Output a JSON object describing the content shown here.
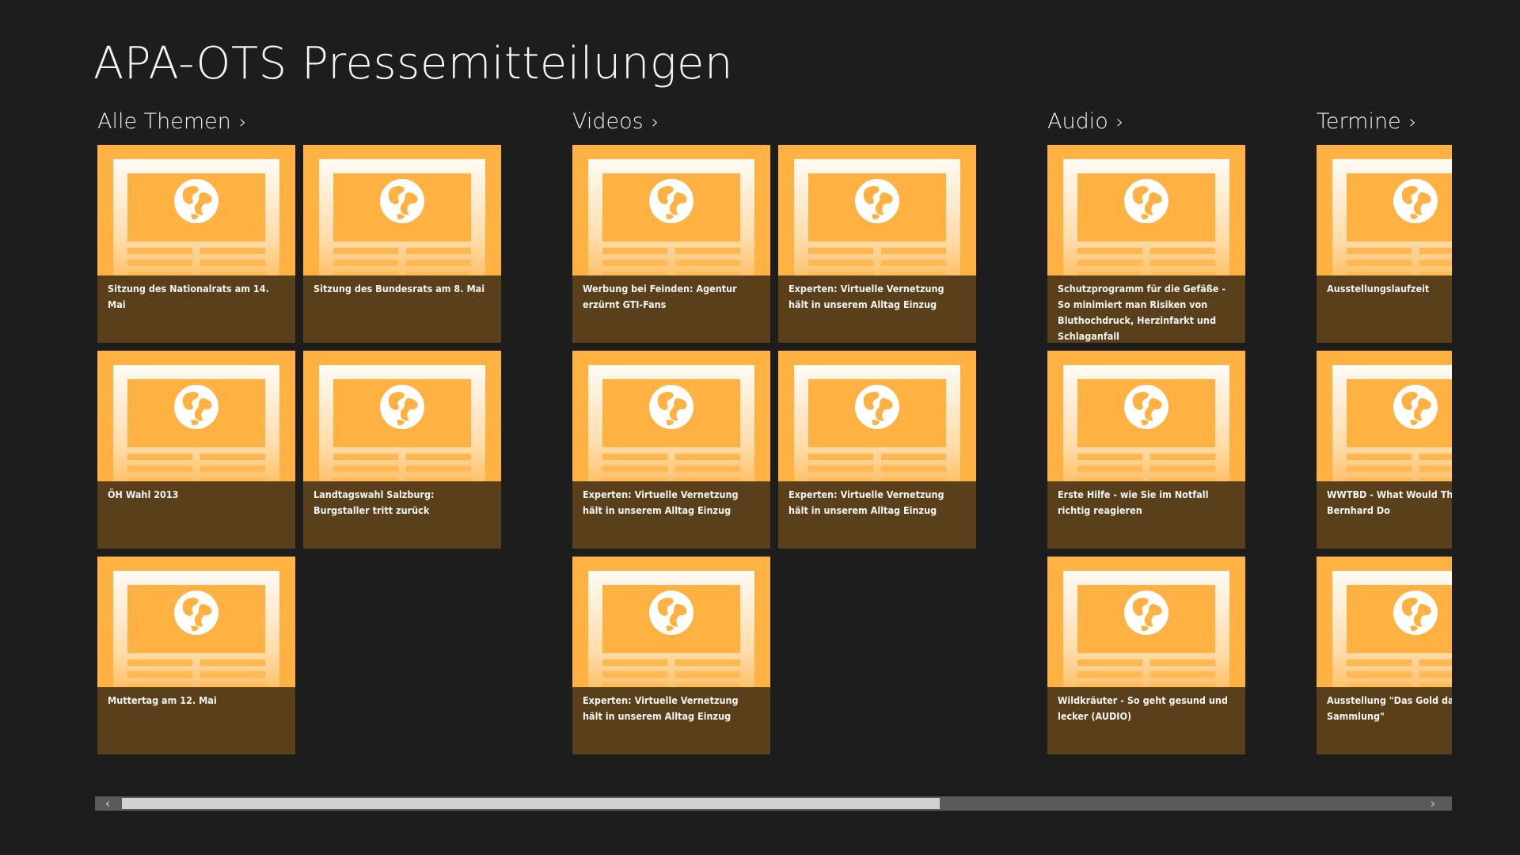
{
  "app": {
    "title": "APA-OTS Pressemitteilungen"
  },
  "icons": {
    "tile_image": "newspaper-globe-icon"
  },
  "colors": {
    "background": "#1d1d1d",
    "tile_image": "#ffb142",
    "tile_caption": "#5a401a"
  },
  "groups": [
    {
      "name": "Alle Themen",
      "tiles": [
        "Sitzung des Nationalrats am 14. Mai",
        "Sitzung des Bundesrats am 8. Mai",
        "ÖH Wahl 2013",
        "Landtagswahl Salzburg: Burgstaller tritt zurück",
        "Muttertag am 12. Mai"
      ]
    },
    {
      "name": "Videos",
      "tiles": [
        "Werbung bei Feinden: Agentur erzürnt GTI-Fans",
        "Experten: Virtuelle Vernetzung hält in unserem Alltag Einzug",
        "Experten: Virtuelle Vernetzung hält in unserem Alltag Einzug",
        "Experten: Virtuelle Vernetzung hält in unserem Alltag Einzug",
        "Experten: Virtuelle Vernetzung hält in unserem Alltag Einzug"
      ]
    },
    {
      "name": "Audio",
      "tiles": [
        "Schutzprogramm für die Gefäße - So minimiert man Risiken von Bluthochdruck, Herzinfarkt und Schlaganfall",
        "Erste Hilfe - wie Sie im Notfall richtig reagieren",
        "Wildkräuter - So geht gesund und lecker (AUDIO)"
      ]
    },
    {
      "name": "Termine",
      "tiles": [
        "Ausstellungslaufzeit",
        "WWTBD - What Would Thomas Bernhard Do",
        "Ausstellung \"Das Gold das Alten Sammlung\""
      ]
    }
  ],
  "scrollbar": {
    "left_glyph": "‹",
    "right_glyph": "›",
    "position_fraction": 0.0,
    "visible_fraction": 0.63
  }
}
